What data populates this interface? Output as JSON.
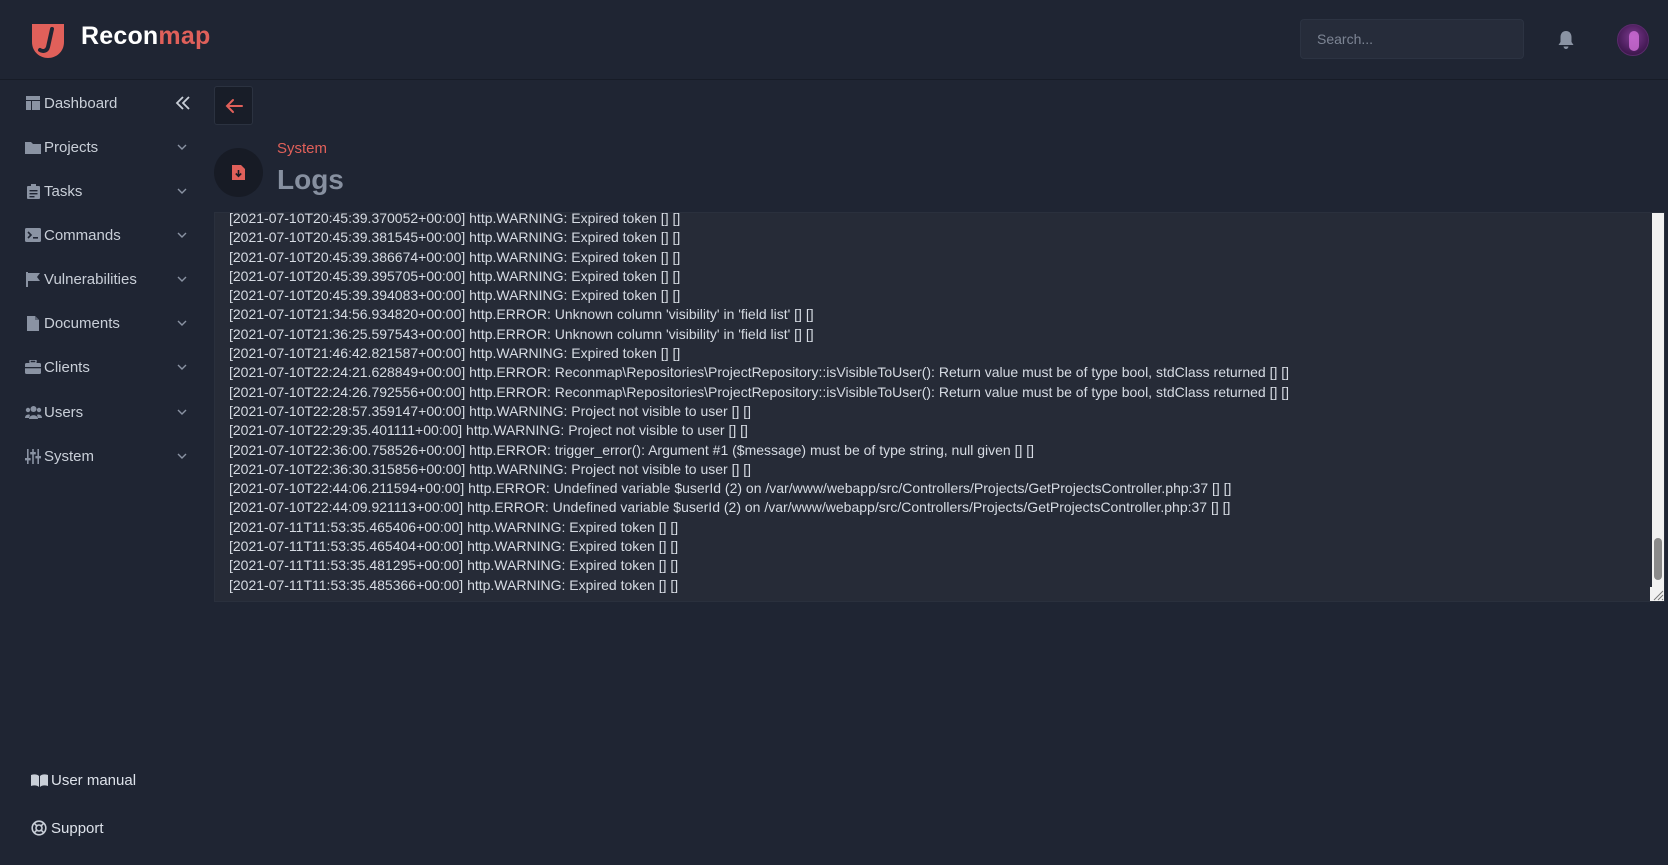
{
  "header": {
    "brand_part1": "Recon",
    "brand_part2": "map",
    "search_placeholder": "Search..."
  },
  "colors": {
    "accent": "#e0605a",
    "background": "#1f2533",
    "log_background": "#262b37"
  },
  "icons": {
    "notifications": "bell-icon",
    "collapse": "double-chevron-left-icon",
    "back": "arrow-left-icon"
  },
  "sidebar": {
    "items": [
      {
        "label": "Dashboard",
        "icon": "dashboard-icon",
        "expandable": false
      },
      {
        "label": "Projects",
        "icon": "folder-icon",
        "expandable": true
      },
      {
        "label": "Tasks",
        "icon": "clipboard-icon",
        "expandable": true
      },
      {
        "label": "Commands",
        "icon": "terminal-icon",
        "expandable": true
      },
      {
        "label": "Vulnerabilities",
        "icon": "flag-icon",
        "expandable": true
      },
      {
        "label": "Documents",
        "icon": "document-icon",
        "expandable": true
      },
      {
        "label": "Clients",
        "icon": "briefcase-icon",
        "expandable": true
      },
      {
        "label": "Users",
        "icon": "users-icon",
        "expandable": true
      },
      {
        "label": "System",
        "icon": "sliders-icon",
        "expandable": true
      }
    ],
    "footer": {
      "manual_label": "User manual",
      "support_label": "Support"
    }
  },
  "page": {
    "breadcrumb": "System",
    "title": "Logs"
  },
  "logs": "[2021-07-10T20:45:39.370052+00:00] http.WARNING: Expired token [] []\n[2021-07-10T20:45:39.381545+00:00] http.WARNING: Expired token [] []\n[2021-07-10T20:45:39.386674+00:00] http.WARNING: Expired token [] []\n[2021-07-10T20:45:39.395705+00:00] http.WARNING: Expired token [] []\n[2021-07-10T20:45:39.394083+00:00] http.WARNING: Expired token [] []\n[2021-07-10T21:34:56.934820+00:00] http.ERROR: Unknown column 'visibility' in 'field list' [] []\n[2021-07-10T21:36:25.597543+00:00] http.ERROR: Unknown column 'visibility' in 'field list' [] []\n[2021-07-10T21:46:42.821587+00:00] http.WARNING: Expired token [] []\n[2021-07-10T22:24:21.628849+00:00] http.ERROR: Reconmap\\Repositories\\ProjectRepository::isVisibleToUser(): Return value must be of type bool, stdClass returned [] []\n[2021-07-10T22:24:26.792556+00:00] http.ERROR: Reconmap\\Repositories\\ProjectRepository::isVisibleToUser(): Return value must be of type bool, stdClass returned [] []\n[2021-07-10T22:28:57.359147+00:00] http.WARNING: Project not visible to user [] []\n[2021-07-10T22:29:35.401111+00:00] http.WARNING: Project not visible to user [] []\n[2021-07-10T22:36:00.758526+00:00] http.ERROR: trigger_error(): Argument #1 ($message) must be of type string, null given [] []\n[2021-07-10T22:36:30.315856+00:00] http.WARNING: Project not visible to user [] []\n[2021-07-10T22:44:06.211594+00:00] http.ERROR: Undefined variable $userId (2) on /var/www/webapp/src/Controllers/Projects/GetProjectsController.php:37 [] []\n[2021-07-10T22:44:09.921113+00:00] http.ERROR: Undefined variable $userId (2) on /var/www/webapp/src/Controllers/Projects/GetProjectsController.php:37 [] []\n[2021-07-11T11:53:35.465406+00:00] http.WARNING: Expired token [] []\n[2021-07-11T11:53:35.465404+00:00] http.WARNING: Expired token [] []\n[2021-07-11T11:53:35.481295+00:00] http.WARNING: Expired token [] []\n[2021-07-11T11:53:35.485366+00:00] http.WARNING: Expired token [] []"
}
